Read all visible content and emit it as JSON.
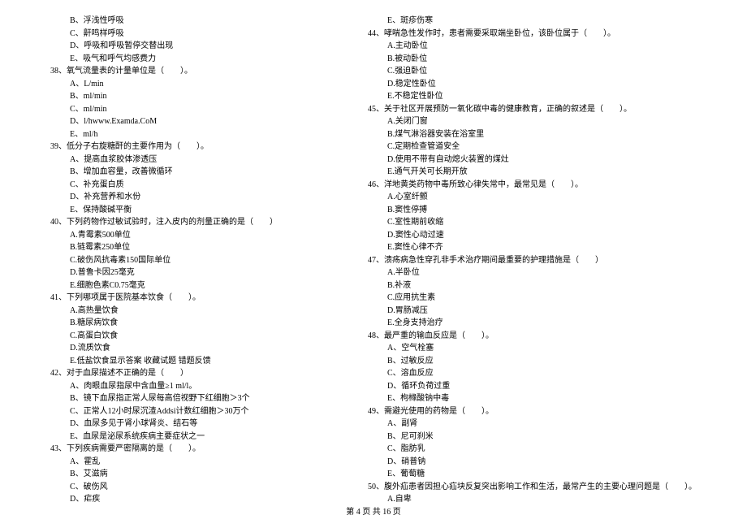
{
  "left": [
    {
      "t": "opt",
      "v": "B、浮浅性呼吸"
    },
    {
      "t": "opt",
      "v": "C、鼾鸣样呼吸"
    },
    {
      "t": "opt",
      "v": "D、呼吸和呼吸暂停交替出现"
    },
    {
      "t": "opt",
      "v": "E、吸气和呼气均感费力"
    },
    {
      "t": "q",
      "v": "38、氧气流量表的计量单位是（　　）。"
    },
    {
      "t": "opt",
      "v": "A、L/min"
    },
    {
      "t": "opt",
      "v": "B、ml/min"
    },
    {
      "t": "opt",
      "v": "C、ml/min"
    },
    {
      "t": "opt",
      "v": "D、l/hwww.Examda.CoM"
    },
    {
      "t": "opt",
      "v": "E、ml/h"
    },
    {
      "t": "q",
      "v": "39、低分子右旋糖酐的主要作用为（　　）。"
    },
    {
      "t": "opt",
      "v": "A、提高血浆胶体渗透压"
    },
    {
      "t": "opt",
      "v": "B、增加血容量，改善微循环"
    },
    {
      "t": "opt",
      "v": "C、补充蛋白质"
    },
    {
      "t": "opt",
      "v": "D、补充营养和水份"
    },
    {
      "t": "opt",
      "v": "E、保持酸碱平衡"
    },
    {
      "t": "q",
      "v": "40、下列药物作过敏试验时，注入皮内的剂量正确的是（　　）"
    },
    {
      "t": "opt",
      "v": "A.青霉素500单位"
    },
    {
      "t": "opt",
      "v": "B.链霉素250单位"
    },
    {
      "t": "opt",
      "v": "C.破伤风抗毒素150国际单位"
    },
    {
      "t": "opt",
      "v": "D.普鲁卡因25毫克"
    },
    {
      "t": "opt",
      "v": "E.细胞色素C0.75毫克"
    },
    {
      "t": "q",
      "v": "41、下列哪项属于医院基本饮食（　　）。"
    },
    {
      "t": "opt",
      "v": "A.高热量饮食"
    },
    {
      "t": "opt",
      "v": "B.糖尿病饮食"
    },
    {
      "t": "opt",
      "v": "C.高蛋白饮食"
    },
    {
      "t": "opt",
      "v": "D.流质饮食"
    },
    {
      "t": "opt",
      "v": "E.低盐饮食显示答案 收藏试题 错题反馈"
    },
    {
      "t": "q",
      "v": "42、对于血尿描述不正确的是（　　）"
    },
    {
      "t": "opt",
      "v": "A、肉眼血尿指尿中含血量≥1 ml/l。"
    },
    {
      "t": "opt",
      "v": "B、镜下血尿指正常人尿每高倍视野下红细胞＞3个"
    },
    {
      "t": "opt",
      "v": "C、正常人12小时尿沉渣Addsi计数红细胞＞30万个"
    },
    {
      "t": "opt",
      "v": "D、血尿多见于肾小球肾炎、结石等"
    },
    {
      "t": "opt",
      "v": "E、血尿是泌尿系统疾病主要症状之一"
    },
    {
      "t": "q",
      "v": "43、下列疾病需要严密隔离的是（　　）。"
    },
    {
      "t": "opt",
      "v": "A、霍乱"
    },
    {
      "t": "opt",
      "v": "B、艾滋病"
    },
    {
      "t": "opt",
      "v": "C、破伤风"
    },
    {
      "t": "opt",
      "v": "D、疟疾"
    }
  ],
  "right": [
    {
      "t": "opt",
      "v": "E、斑疹伤寒"
    },
    {
      "t": "q",
      "v": "44、哮喘急性发作时，患者需要采取端坐卧位，该卧位属于（　　）。"
    },
    {
      "t": "opt",
      "v": "A.主动卧位"
    },
    {
      "t": "opt",
      "v": "B.被动卧位"
    },
    {
      "t": "opt",
      "v": "C.强迫卧位"
    },
    {
      "t": "opt",
      "v": "D.稳定性卧位"
    },
    {
      "t": "opt",
      "v": "E.不稳定性卧位"
    },
    {
      "t": "q",
      "v": "45、关于社区开展预防一氧化碳中毒的健康教育，正确的叙述是（　　）。"
    },
    {
      "t": "opt",
      "v": "A.关闭门窗"
    },
    {
      "t": "opt",
      "v": "B.煤气淋浴器安装在浴室里"
    },
    {
      "t": "opt",
      "v": "C.定期检查管道安全"
    },
    {
      "t": "opt",
      "v": "D.使用不带有自动熄火装置的煤灶"
    },
    {
      "t": "opt",
      "v": "E.通气开关可长期开放"
    },
    {
      "t": "q",
      "v": "46、洋地黄类药物中毒所致心律失常中，最常见是（　　）。"
    },
    {
      "t": "opt",
      "v": "A.心室纤颤"
    },
    {
      "t": "opt",
      "v": "B.窦性停搏"
    },
    {
      "t": "opt",
      "v": "C.室性期前收缩"
    },
    {
      "t": "opt",
      "v": "D.窦性心动过速"
    },
    {
      "t": "opt",
      "v": "E.窦性心律不齐"
    },
    {
      "t": "q",
      "v": "47、溃疡病急性穿孔非手术治疗期间最重要的护理措施是（　　）"
    },
    {
      "t": "opt",
      "v": "A.半卧位"
    },
    {
      "t": "opt",
      "v": "B.补液"
    },
    {
      "t": "opt",
      "v": "C.应用抗生素"
    },
    {
      "t": "opt",
      "v": "D.胃肠减压"
    },
    {
      "t": "opt",
      "v": "E.全身支持治疗"
    },
    {
      "t": "q",
      "v": "48、最严重的输血反应是（　　）。"
    },
    {
      "t": "opt",
      "v": "A、空气栓塞"
    },
    {
      "t": "opt",
      "v": "B、过敏反应"
    },
    {
      "t": "opt",
      "v": "C、溶血反应"
    },
    {
      "t": "opt",
      "v": "D、循环负荷过重"
    },
    {
      "t": "opt",
      "v": "E、枸橼酸钠中毒"
    },
    {
      "t": "q",
      "v": "49、需避光使用的药物是（　　）。"
    },
    {
      "t": "opt",
      "v": "A、副肾"
    },
    {
      "t": "opt",
      "v": "B、尼可刹米"
    },
    {
      "t": "opt",
      "v": "C、脂肪乳"
    },
    {
      "t": "opt",
      "v": "D、硝普钠"
    },
    {
      "t": "opt",
      "v": "E、葡萄糖"
    },
    {
      "t": "q",
      "v": "50、腹外疝患者因担心疝块反复突出影响工作和生活，最常产生的主要心理问题是（　　）。"
    },
    {
      "t": "opt",
      "v": "A.自卑"
    }
  ],
  "footer": "第 4 页 共 16 页"
}
